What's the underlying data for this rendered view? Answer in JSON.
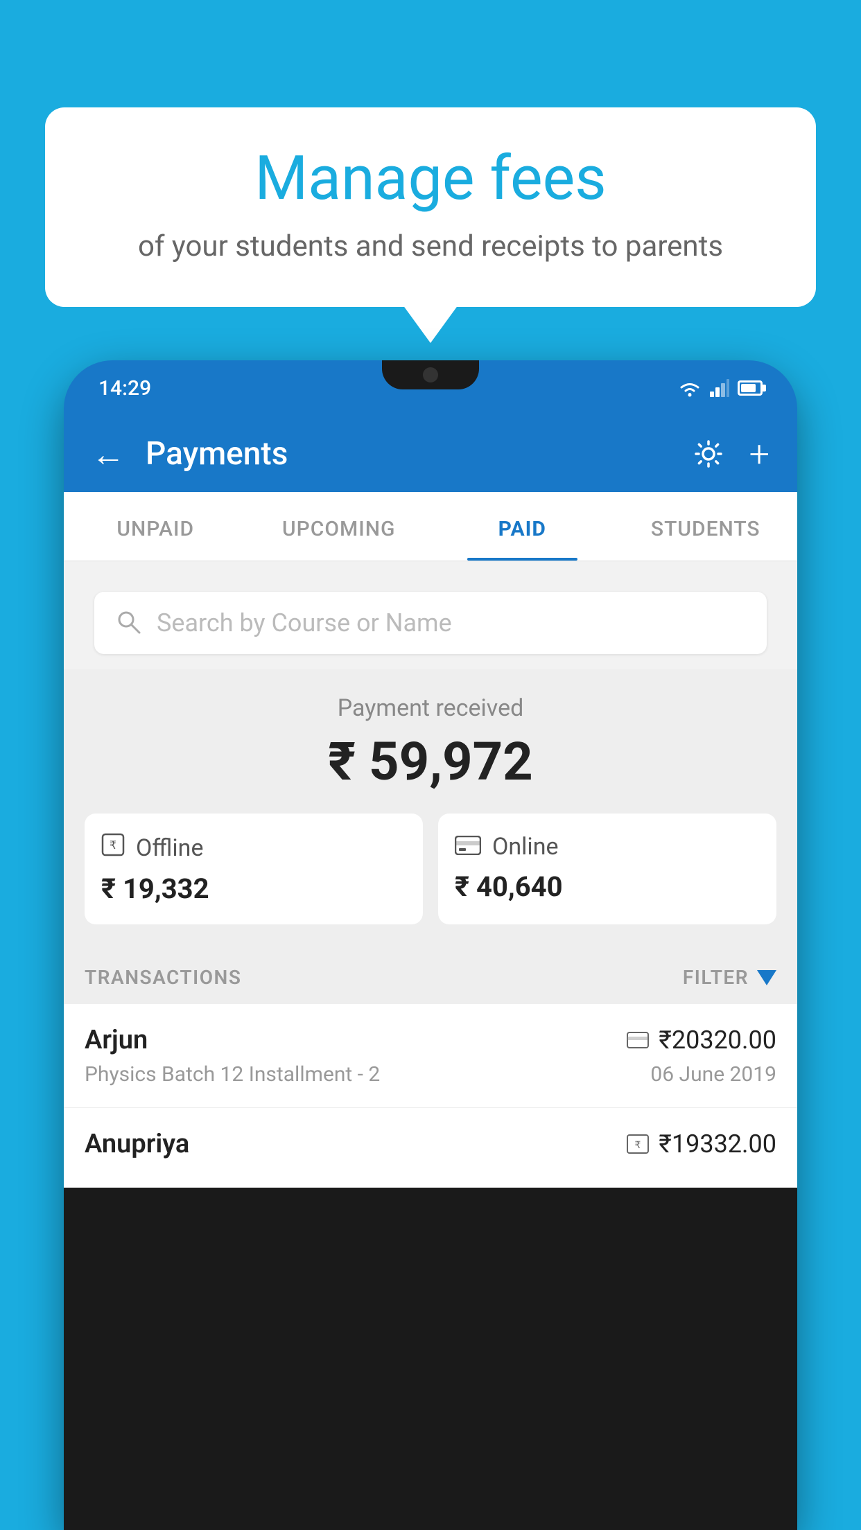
{
  "background": {
    "color": "#1AACDF"
  },
  "speech_bubble": {
    "title": "Manage fees",
    "subtitle": "of your students and send receipts to parents"
  },
  "phone": {
    "status_bar": {
      "time": "14:29",
      "wifi": true,
      "signal": true,
      "battery": true
    },
    "app_header": {
      "back_label": "←",
      "title": "Payments",
      "settings_icon": "gear",
      "add_icon": "+"
    },
    "tabs": [
      {
        "label": "UNPAID",
        "active": false
      },
      {
        "label": "UPCOMING",
        "active": false
      },
      {
        "label": "PAID",
        "active": true
      },
      {
        "label": "STUDENTS",
        "active": false
      }
    ],
    "search": {
      "placeholder": "Search by Course or Name"
    },
    "payment_summary": {
      "label": "Payment received",
      "amount": "₹ 59,972",
      "cards": [
        {
          "icon": "rupee-offline",
          "type": "Offline",
          "amount": "₹ 19,332"
        },
        {
          "icon": "card-online",
          "type": "Online",
          "amount": "₹ 40,640"
        }
      ]
    },
    "transactions_header": {
      "label": "TRANSACTIONS",
      "filter_label": "FILTER"
    },
    "transactions": [
      {
        "name": "Arjun",
        "amount": "₹20320.00",
        "detail": "Physics Batch 12 Installment - 2",
        "date": "06 June 2019",
        "payment_icon": "card"
      },
      {
        "name": "Anupriya",
        "amount": "₹19332.00",
        "detail": "",
        "date": "",
        "payment_icon": "rupee"
      }
    ]
  }
}
